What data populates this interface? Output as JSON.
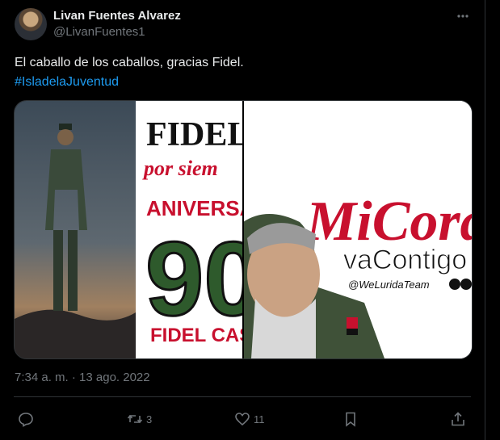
{
  "author": {
    "display_name": "Livan Fuentes Alvarez",
    "handle": "@LivanFuentes1"
  },
  "tweet": {
    "text": "El caballo de los caballos, gracias Fidel.",
    "hashtag": "#IsladelaJuventud",
    "timestamp": "7:34 a. m. · 13 ago. 2022"
  },
  "media": {
    "left_image": {
      "title": "FIDEL",
      "subtitle": "por siem",
      "banner": "ANIVERSA",
      "number": "90",
      "footer": "FIDEL CAS"
    },
    "right_image": {
      "title": "MiCora",
      "subtitle": "vaContigo",
      "credit": "@WeLuridaTeam"
    }
  },
  "actions": {
    "reply_count": "",
    "retweet_count": "3",
    "like_count": "11",
    "bookmark_count": ""
  },
  "colors": {
    "background": "#000000",
    "text": "#e7e9ea",
    "muted": "#71767b",
    "link": "#1d9bf0",
    "border": "#2f3336"
  }
}
